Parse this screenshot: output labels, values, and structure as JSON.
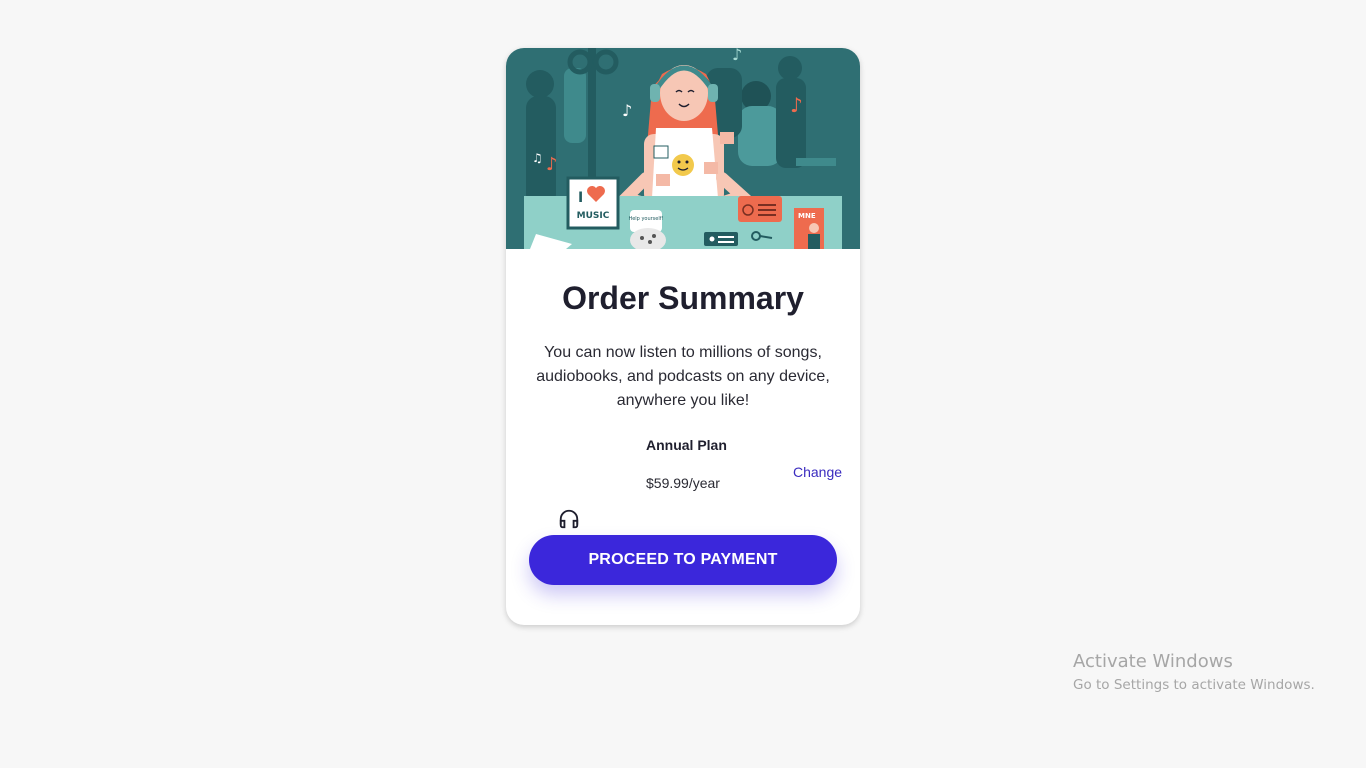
{
  "hero": {
    "logo_text": "MUSIC",
    "book_text": "MNE",
    "sign_text": "Help yourself!"
  },
  "summary": {
    "title": "Order Summary",
    "description": "You can now listen to millions of songs, audiobooks, and podcasts on any device, anywhere you like!"
  },
  "plan": {
    "icon": "headphones-icon",
    "name": "Annual Plan",
    "price": "$59.99/year",
    "change_label": "Change"
  },
  "actions": {
    "proceed_label": "PROCEED TO PAYMENT"
  },
  "watermark": {
    "title": "Activate Windows",
    "subtitle": "Go to Settings to activate Windows."
  },
  "colors": {
    "accent": "#3b27db",
    "link": "#3a2bbf",
    "background": "#f7f7f7",
    "hero_teal": "#2a6f74"
  }
}
